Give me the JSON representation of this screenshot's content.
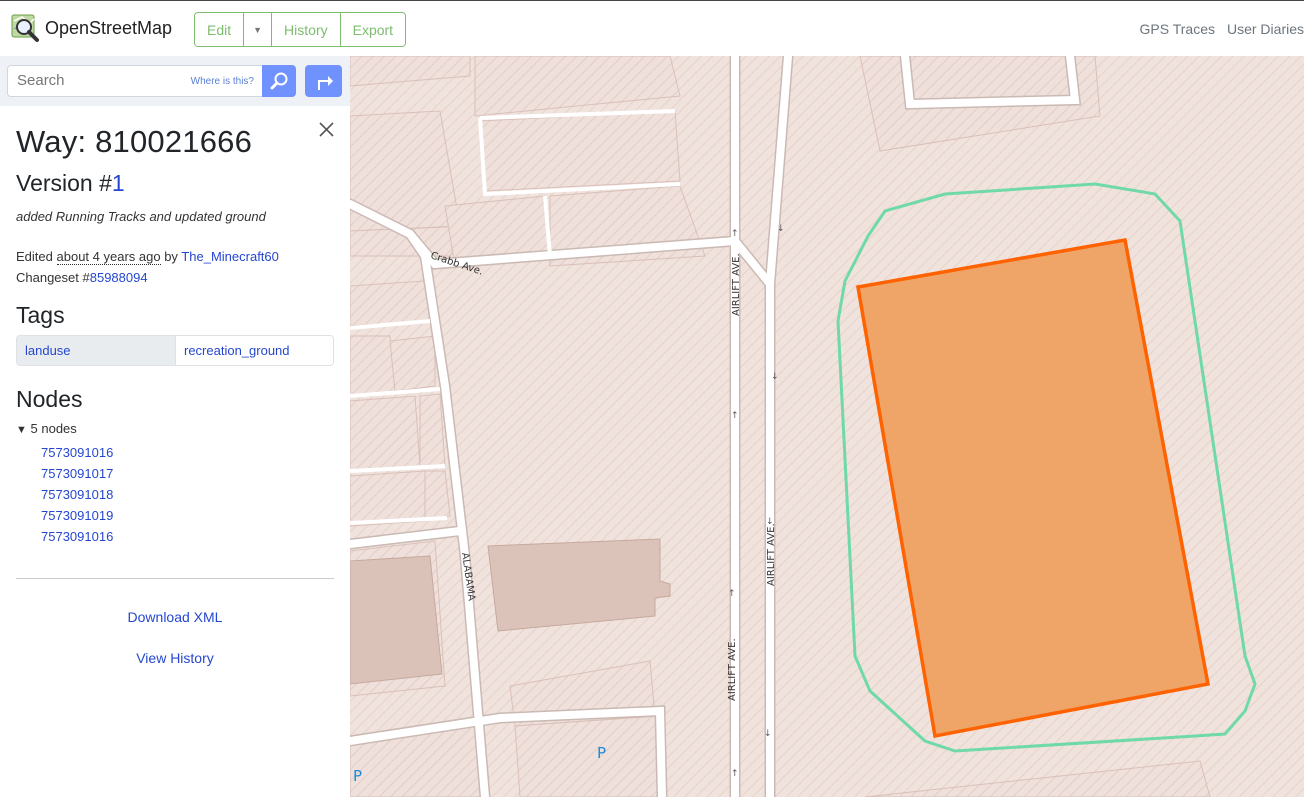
{
  "header": {
    "brand": "OpenStreetMap",
    "edit_label": "Edit",
    "history_label": "History",
    "export_label": "Export",
    "links": [
      "GPS Traces",
      "User Diaries"
    ]
  },
  "search": {
    "placeholder": "Search",
    "where_label": "Where is this?"
  },
  "feature": {
    "title": "Way: 810021666",
    "version_prefix": "Version #",
    "version": "1",
    "comment": "added Running Tracks and updated ground",
    "edited_prefix": "Edited",
    "edited_time": "about 4 years ago",
    "edited_by": "by",
    "user": "The_Minecraft60",
    "changeset_prefix": "Changeset #",
    "changeset": "85988094"
  },
  "tags": {
    "heading": "Tags",
    "rows": [
      {
        "key": "landuse",
        "value": "recreation_ground"
      }
    ]
  },
  "nodes": {
    "heading": "Nodes",
    "summary": "5 nodes",
    "items": [
      "7573091016",
      "7573091017",
      "7573091018",
      "7573091019",
      "7573091016"
    ]
  },
  "actions": {
    "download_xml": "Download XML",
    "view_history": "View History"
  },
  "map": {
    "street_labels": [
      "Crabb Ave.",
      "AIRLIFT AVE.",
      "AIRLIFT AVE.",
      "AIRLIFT AVE.",
      "ALABAMA"
    ],
    "parking_label": "P",
    "highlight_color": "#ff6200",
    "track_color": "#6fd9a8"
  }
}
